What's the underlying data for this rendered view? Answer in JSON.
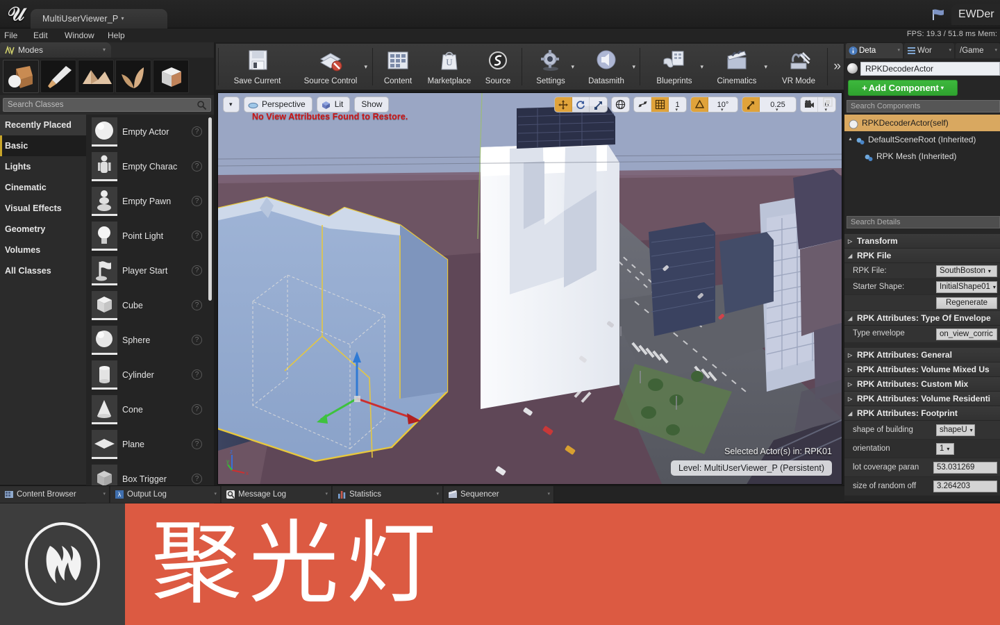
{
  "titlebar": {
    "logo": "unreal-u-logo",
    "project_tab": "MultiUserViewer_P",
    "right_tab": "EWDer",
    "flag_icon": "flag-icon"
  },
  "menubar": {
    "items": [
      "File",
      "Edit",
      "Window",
      "Help"
    ],
    "stats": "FPS: 19.3 / 51.8 ms  Mem:",
    "fps_value": "19.3",
    "frame_ms": "51.8 ms"
  },
  "toolbar": {
    "items": [
      {
        "label": "Save Current",
        "icon": "floppy-disk-icon",
        "caret": false
      },
      {
        "label": "Source Control",
        "icon": "source-control-icon",
        "caret": true
      },
      {
        "label": "Content",
        "icon": "content-grid-icon",
        "caret": false
      },
      {
        "label": "Marketplace",
        "icon": "marketplace-bag-icon",
        "caret": false
      },
      {
        "label": "Source",
        "icon": "source-sphere-icon",
        "caret": false
      },
      {
        "label": "Settings",
        "icon": "gear-icon",
        "caret": true
      },
      {
        "label": "Datasmith",
        "icon": "datasmith-icon",
        "caret": true
      },
      {
        "label": "Blueprints",
        "icon": "blueprint-icon",
        "caret": true
      },
      {
        "label": "Cinematics",
        "icon": "clapperboard-icon",
        "caret": true
      },
      {
        "label": "VR Mode",
        "icon": "vr-tools-icon",
        "caret": false
      }
    ],
    "overflow": "»"
  },
  "modes": {
    "tab_label": "Modes",
    "tab_icon": "modes-icon",
    "mode_buttons": [
      {
        "name": "place-mode",
        "icon": "place-cube-icon",
        "selected": true
      },
      {
        "name": "paint-mode",
        "icon": "paint-brush-icon",
        "selected": false
      },
      {
        "name": "landscape-mode",
        "icon": "landscape-icon",
        "selected": false
      },
      {
        "name": "foliage-mode",
        "icon": "foliage-leaf-icon",
        "selected": false
      },
      {
        "name": "geometry-edit-mode",
        "icon": "geometry-box-icon",
        "selected": false
      }
    ],
    "search_placeholder": "Search Classes",
    "categories": [
      {
        "label": "Recently Placed",
        "state": "hover"
      },
      {
        "label": "Basic",
        "state": "active"
      },
      {
        "label": "Lights",
        "state": "normal"
      },
      {
        "label": "Cinematic",
        "state": "normal"
      },
      {
        "label": "Visual Effects",
        "state": "normal"
      },
      {
        "label": "Geometry",
        "state": "normal"
      },
      {
        "label": "Volumes",
        "state": "normal"
      },
      {
        "label": "All Classes",
        "state": "normal"
      }
    ],
    "classes": [
      {
        "label": "Empty Actor",
        "icon": "sphere-thumb"
      },
      {
        "label": "Empty Charac",
        "icon": "character-thumb"
      },
      {
        "label": "Empty Pawn",
        "icon": "pawn-thumb"
      },
      {
        "label": "Point Light",
        "icon": "pointlight-thumb"
      },
      {
        "label": "Player Start",
        "icon": "playerstart-thumb"
      },
      {
        "label": "Cube",
        "icon": "cube-thumb"
      },
      {
        "label": "Sphere",
        "icon": "sphere2-thumb"
      },
      {
        "label": "Cylinder",
        "icon": "cylinder-thumb"
      },
      {
        "label": "Cone",
        "icon": "cone-thumb"
      },
      {
        "label": "Plane",
        "icon": "plane-thumb"
      },
      {
        "label": "Box Trigger",
        "icon": "boxtrigger-thumb"
      }
    ]
  },
  "viewport": {
    "view_mode_caret": "▾",
    "perspective_label": "Perspective",
    "lit_label": "Lit",
    "show_label": "Show",
    "warning_message": "No View Attributes Found to Restore.",
    "transform_tools": [
      "translate-icon",
      "rotate-icon",
      "scale-icon"
    ],
    "coord_space": "world-globe-icon",
    "surface_snap": "surface-snap-icon",
    "grid_snap_icon": "grid-icon",
    "grid_snap_value": "1",
    "angle_snap_icon": "angle-icon",
    "angle_snap_value": "10°",
    "scale_snap_icon": "scale-snap-icon",
    "scale_snap_value": "0.25",
    "camera_speed_icon": "camera-icon",
    "camera_speed_value": "6",
    "maximize_icon": "maximize-icon",
    "selected_actor_text": "Selected Actor(s) in:  RPK01",
    "level_text": "Level:  MultiUserViewer_P (Persistent)",
    "gizmo": "axis-gizmo"
  },
  "details": {
    "tabs": [
      {
        "label": "Deta",
        "icon": "details-info-icon",
        "active": true
      },
      {
        "label": "Wor",
        "icon": "world-outliner-icon",
        "active": false
      },
      {
        "label": "/Game",
        "icon": "",
        "active": false
      }
    ],
    "actor_name": "RPKDecoderActor",
    "add_component_label": "Add Component",
    "search_components_placeholder": "Search Components",
    "components": [
      {
        "label": "RPKDecoderActor(self)",
        "indent": 0,
        "selected": true,
        "icon": "actor-ball-icon",
        "arrow": ""
      },
      {
        "label": "DefaultSceneRoot (Inherited)",
        "indent": 1,
        "selected": false,
        "icon": "scene-component-icon",
        "arrow": "▲"
      },
      {
        "label": "RPK Mesh (Inherited)",
        "indent": 2,
        "selected": false,
        "icon": "mesh-component-icon",
        "arrow": ""
      }
    ],
    "search_details_placeholder": "Search Details",
    "sections": [
      {
        "title": "Transform",
        "expanded": false,
        "rows": []
      },
      {
        "title": "RPK File",
        "expanded": true,
        "rows": [
          {
            "label": "RPK File:",
            "value": "SouthBoston",
            "type": "combo"
          },
          {
            "label": "Starter Shape:",
            "value": "InitialShape01",
            "type": "combo"
          },
          {
            "label": "",
            "value": "Regenerate",
            "type": "button"
          }
        ]
      },
      {
        "title": "RPK Attributes: Type Of Envelope",
        "expanded": true,
        "rows": [
          {
            "label": "Type envelope",
            "value": "on_view_corric",
            "type": "combo"
          }
        ]
      },
      {
        "title": "RPK Attributes: General",
        "expanded": false,
        "rows": []
      },
      {
        "title": "RPK Attributes: Volume Mixed Us",
        "expanded": false,
        "rows": []
      },
      {
        "title": "RPK Attributes: Custom Mix",
        "expanded": false,
        "rows": []
      },
      {
        "title": "RPK Attributes: Volume Residenti",
        "expanded": false,
        "rows": []
      },
      {
        "title": "RPK Attributes: Footprint",
        "expanded": true,
        "rows": [
          {
            "label": "shape of building",
            "value": "shapeU",
            "type": "combo-sm"
          },
          {
            "label": "orientation",
            "value": "1",
            "type": "combo-xs"
          },
          {
            "label": "lot coverage paran",
            "value": "53.031269",
            "type": "number"
          },
          {
            "label": "size of random off",
            "value": "3.264203",
            "type": "number"
          }
        ]
      }
    ]
  },
  "bottom_tabs": [
    {
      "label": "Content Browser",
      "icon": "content-browser-icon"
    },
    {
      "label": "Output Log",
      "icon": "output-log-icon"
    },
    {
      "label": "Message Log",
      "icon": "message-log-icon"
    },
    {
      "label": "Statistics",
      "icon": "statistics-icon"
    },
    {
      "label": "Sequencer",
      "icon": "sequencer-icon"
    }
  ],
  "banner": {
    "logo_icon": "unreal-engine-logo",
    "text": "聚光灯",
    "background_color": "#dc5a42",
    "logo_background": "#3d3d3d",
    "text_color": "#ffffff"
  }
}
